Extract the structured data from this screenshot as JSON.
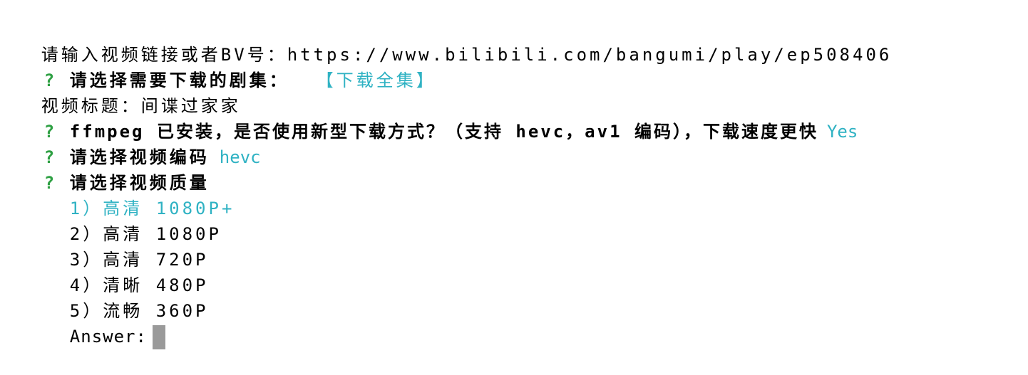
{
  "colors": {
    "question_mark": "#2ea043",
    "answer_accent": "#2fb2c3",
    "cursor": "#9a9a9a",
    "background": "#ffffff",
    "text": "#000000"
  },
  "lines": {
    "input_prompt": "请输入视频链接或者BV号：https://www.bilibili.com/bangumi/play/ep508406",
    "q1": {
      "mark": "?",
      "question": "请选择需要下载的剧集：",
      "answer": "【下载全集】"
    },
    "video_title": "视频标题：间谍过家家",
    "q2": {
      "mark": "?",
      "question": "ffmpeg 已安装，是否使用新型下载方式？（支持 hevc，av1 编码），下载速度更快",
      "answer": "Yes"
    },
    "q3": {
      "mark": "?",
      "question": "请选择视频编码",
      "answer": "hevc"
    },
    "q4": {
      "mark": "?",
      "question": "请选择视频质量"
    }
  },
  "quality_options": [
    "1）高清 1080P+",
    "2）高清 1080P",
    "3）高清 720P",
    "4）清晰 480P",
    "5）流畅 360P"
  ],
  "answer_prompt": "Answer:"
}
